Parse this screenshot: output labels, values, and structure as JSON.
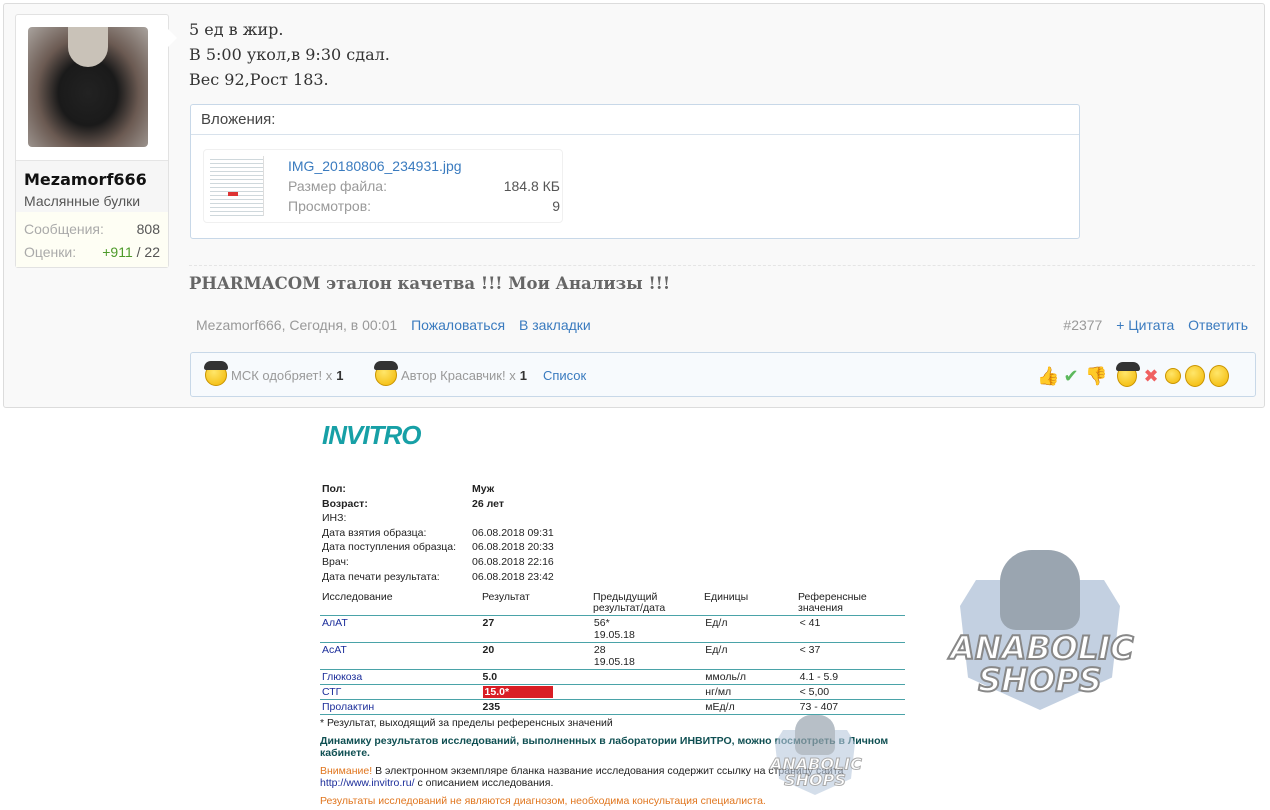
{
  "user": {
    "name": "Mezamorf666",
    "title": "Маслянные булки",
    "stats": [
      {
        "label": "Сообщения:",
        "value": "808"
      },
      {
        "label": "Оценки:",
        "positive": "+911",
        "rest": " / 22"
      }
    ]
  },
  "message": {
    "lines": [
      "5 ед в жир.",
      "В 5:00 укол,в 9:30 сдал.",
      "Вес 92,Рост 183."
    ]
  },
  "attachments": {
    "header": "Вложения:",
    "file": {
      "name": "IMG_20180806_234931.jpg",
      "size_label": "Размер файла:",
      "size": "184.8 КБ",
      "views_label": "Просмотров:",
      "views": "9"
    }
  },
  "signature": "PHARMACOM эталон качетва !!! Мои Анализы !!!",
  "meta": {
    "author_date": "Mezamorf666, Сегодня, в 00:01",
    "report": "Пожаловаться",
    "bookmark": "В закладки",
    "post_number": "#2377",
    "quote": "+ Цитата",
    "reply": "Ответить"
  },
  "likes": {
    "items": [
      {
        "label": "МСК одобряет! x",
        "count": "1"
      },
      {
        "label": "Автор Красавчик! x",
        "count": "1"
      }
    ],
    "list": "Список",
    "rating_icons": [
      "thumbs-up",
      "check",
      "thumbs-down",
      "beret-smiley",
      "cross",
      "grin",
      "sad",
      "medal"
    ]
  },
  "document": {
    "logo": "INVITRO",
    "info": [
      {
        "k": "Пол:",
        "v": "Муж",
        "bold": true
      },
      {
        "k": "Возраст:",
        "v": "26 лет",
        "bold": true
      },
      {
        "k": "ИНЗ:",
        "v": ""
      },
      {
        "k": "Дата взятия образца:",
        "v": "06.08.2018 09:31"
      },
      {
        "k": "Дата поступления образца:",
        "v": "06.08.2018 20:33"
      },
      {
        "k": "Врач:",
        "v": "06.08.2018 22:16"
      },
      {
        "k": "Дата печати результата:",
        "v": "06.08.2018 23:42"
      }
    ],
    "headers": [
      "Исследование",
      "Результат",
      "Предыдущий результат/дата",
      "Единицы",
      "Референсные значения"
    ],
    "rows": [
      [
        "АлАТ",
        "27",
        "56*\n19.05.18",
        "Ед/л",
        "< 41"
      ],
      [
        "АсАТ",
        "20",
        "28\n19.05.18",
        "Ед/л",
        "< 37"
      ],
      [
        "Глюкоза",
        "5.0",
        "",
        "ммоль/л",
        "4.1 - 5.9"
      ],
      [
        "СТГ",
        "15.0*",
        "",
        "нг/мл",
        "< 5,00"
      ],
      [
        "Пролактин",
        "235",
        "",
        "мЕд/л",
        "73 - 407"
      ]
    ],
    "note": "* Результат, выходящий за пределы референсных значений",
    "dynamics": "Динамику результатов исследований, выполненных в лаборатории ИНВИТРО, можно посмотреть в Личном кабинете.",
    "attention": "Внимание!",
    "attention_text": " В электронном экземпляре бланка название исследования содержит ссылку на страницу сайта ",
    "url": "http://www.invitro.ru/",
    "url_tail": " с описанием исследования.",
    "disclaimer": "Результаты исследований не являются диагнозом, необходима консультация специалиста."
  },
  "watermark": "ANABOLIC SHOPS",
  "colors": {
    "link": "#3a7bbf",
    "accent": "#17a0a6",
    "alert": "#d91e25"
  }
}
